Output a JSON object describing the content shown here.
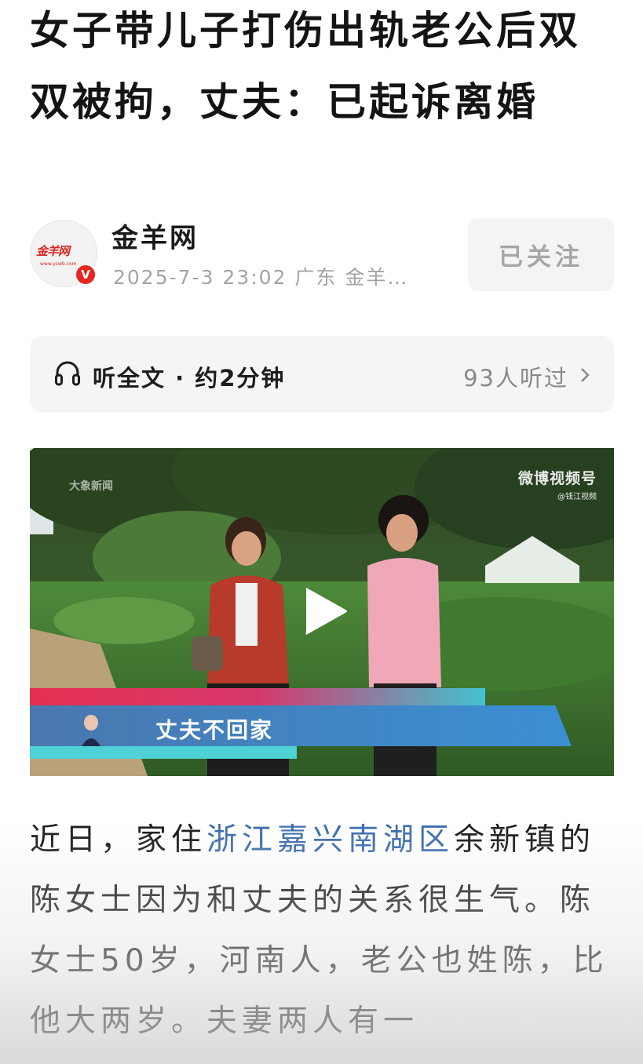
{
  "article": {
    "title": "女子带儿子打伤出轨老公后双双被拘，丈夫：已起诉离婚"
  },
  "author": {
    "name": "金羊网",
    "avatar_logo": "金羊网",
    "avatar_url": "www.ycwb.com",
    "verified_badge": "V",
    "meta": "2025-7-3 23:02 广东 金羊…",
    "follow_label": "已关注"
  },
  "listen": {
    "label": "听全文 · 约2分钟",
    "count": "93人听过"
  },
  "video": {
    "watermark_left": "大象新闻",
    "watermark_right": "微博视频号",
    "watermark_right_sub": "@钱江视频",
    "caption": "丈夫不回家"
  },
  "body": {
    "p1_before": "近日，家住",
    "p1_highlight": "浙江嘉兴南湖区",
    "p1_after": "余新镇的陈女士因为和丈夫的关系很生气。陈女士50岁，河南人，老公也姓陈，比他大两岁。夫妻两人有一"
  },
  "colors": {
    "link": "#3b6cae",
    "badge_red": "#e8251f",
    "muted": "#a3a3a3"
  }
}
